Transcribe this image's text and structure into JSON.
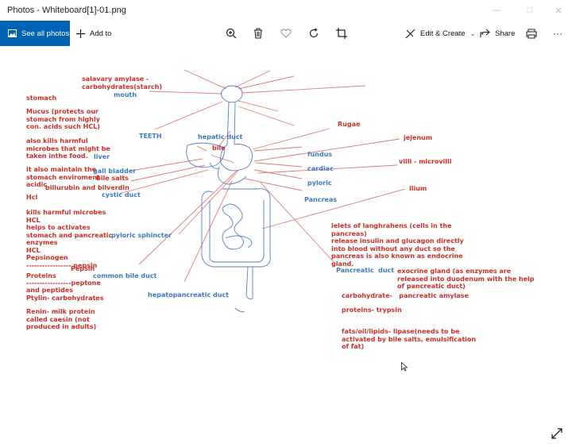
{
  "window": {
    "title": "Photos - Whiteboard[1]-01.png"
  },
  "toolbar": {
    "see_all_label": "See all photos",
    "add_to_label": "Add to",
    "edit_create_label": "Edit & Create",
    "share_label": "Share",
    "more_label": "···"
  },
  "colors": {
    "accent": "#0063b1",
    "red_text": "#c8302a",
    "blue_text": "#3a7bbf"
  },
  "notes": {
    "salivary": "salavary amylase -\ncarbohydrates(starch)",
    "mouth": "mouth",
    "stomach": "stomach",
    "mucus": "Mucus (protects our\nstomach from highly\ncon. acids such HCL)",
    "teeth": "TEETH",
    "hepatic_duct": "hepatic duct",
    "rugae": "Rugae",
    "jejenum": "jejenum",
    "microbes": "also kills harmful\nmicrobes that might be\ntaken inthe food.",
    "bile": "bile",
    "liver": "liver",
    "fundus": "fundus",
    "villi": "villi - microvilli",
    "maintain": "it also maintain the\nstomach enviroment\nacidic",
    "gall_bladder": "gall bladder",
    "bile_salts": "bile salts",
    "cardiac": "cardiac",
    "billirubin": "billurubin and bilverdin",
    "cystic_duct": "cystic duct",
    "pyloric": "pyloric",
    "ilium": "ilium",
    "hcl": "Hcl",
    "pancreas": "Pancreas",
    "hcl_list": "kills harmful microbes\nHCL\nhelps to activates\nstomach and pancreatic\nenzymes\nHCL\nPepsinogen\n----------------- pepsin",
    "pyloric_sphincter": "pyloric sphincter",
    "ielets": "ielets of langhrahens (cells in the\npancreas)\nrelease insulin and glucagon directly\ninto blood without any duct so the\npancreas is also known as endocrine\ngland.",
    "pepsin": "Pepsin",
    "proteins": "Proteins",
    "peptone": "-----------------peptone",
    "peptides": "and peptides\nPtylin- carbohydrates",
    "common_bile_duct": "common bile duct",
    "pancreatic_duct": "Pancreatic  duct",
    "exocrine": "exocrine gland (as enzymes are\nreleased into duodenum with the help\nof pancreatic duct)",
    "hepatopancreatic": "hepatopancreatic duct",
    "carbohydrate": "carbohydrate-   pancreatic amylase",
    "renin": "Renin- milk protein\ncalled caesin (not\nproduced in adults)",
    "proteins_trypsin": "proteins- trypsin",
    "fats": "fats/oil/lipids- lipase(needs to be\nactivated by bile salts, emulsification\nof fat)"
  }
}
